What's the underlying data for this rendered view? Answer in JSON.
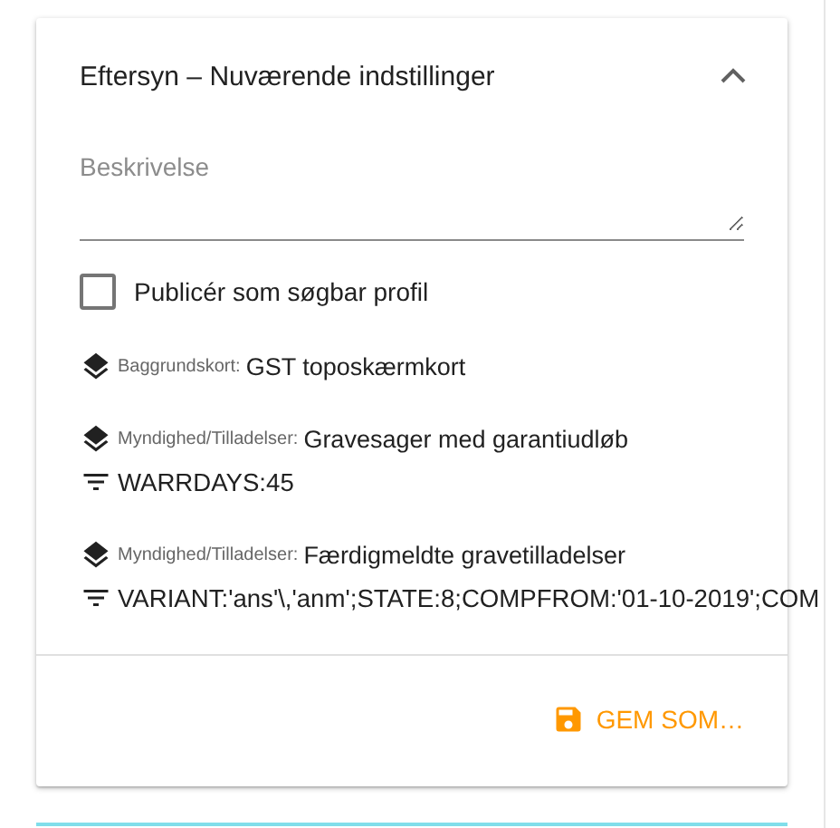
{
  "panel": {
    "title": "Eftersyn – Nuværende indstillinger",
    "expanded": true
  },
  "description": {
    "placeholder": "Beskrivelse"
  },
  "publish": {
    "label": "Publicér som søgbar profil",
    "checked": false
  },
  "layers": [
    {
      "category": "Baggrundskort:",
      "name": "GST toposkærmkort"
    },
    {
      "category": "Myndighed/Tilladelser:",
      "name": "Gravesager med garantiudløb",
      "filter": "WARRDAYS:45"
    },
    {
      "category": "Myndighed/Tilladelser:",
      "name": "Færdigmeldte gravetilladelser",
      "filter": "VARIANT:'ans'\\,'anm';STATE:8;COMPFROM:'01-10-2019';COM"
    }
  ],
  "actions": [
    {
      "label": "GEM SOM…"
    }
  ]
}
